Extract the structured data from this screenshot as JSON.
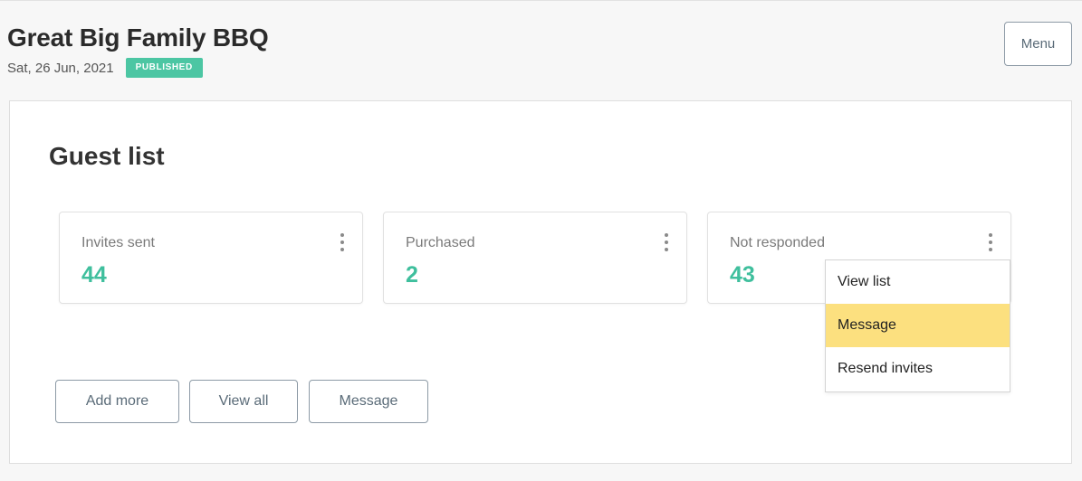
{
  "event": {
    "title": "Great Big Family BBQ",
    "date": "Sat, 26 Jun, 2021",
    "status": "PUBLISHED"
  },
  "header": {
    "menu_label": "Menu"
  },
  "guest_list": {
    "title": "Guest list",
    "stats": [
      {
        "label": "Invites sent",
        "value": "44"
      },
      {
        "label": "Purchased",
        "value": "2"
      },
      {
        "label": "Not responded",
        "value": "43"
      }
    ],
    "dropdown": {
      "items": [
        "View list",
        "Message",
        "Resend invites"
      ],
      "highlighted": "Message"
    },
    "actions": [
      "Add more",
      "View all",
      "Message"
    ]
  },
  "colors": {
    "accent": "#3fbf9d",
    "badge": "#4cc6a3",
    "highlight": "#fce07f",
    "button_border": "#8d9aa6"
  }
}
